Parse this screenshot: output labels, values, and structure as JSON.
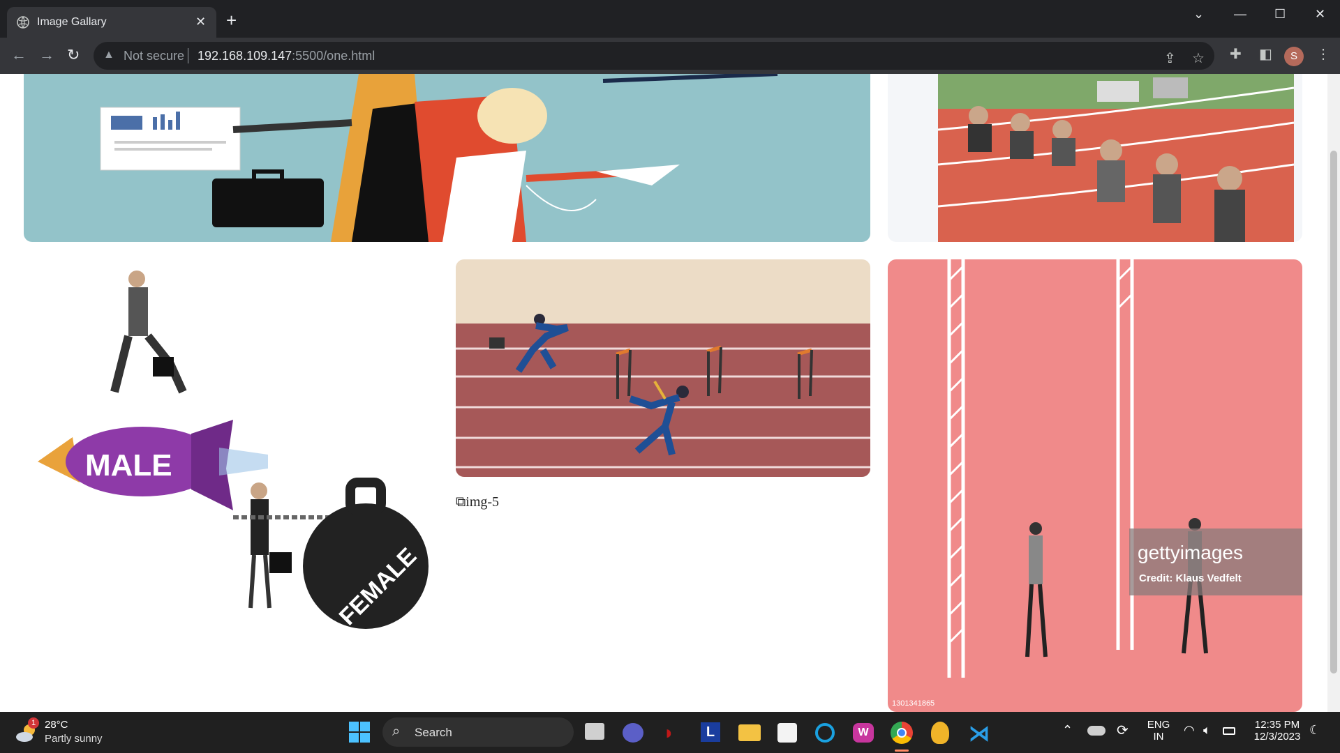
{
  "browser": {
    "tab_title": "Image Gallary",
    "url_warning": "Not secure",
    "url_host": "192.168.109.147",
    "url_rest": ":5500/one.html",
    "profile_initial": "S"
  },
  "gallery": {
    "broken_image_alt": "img-5",
    "watermark_brand": "gettyimages",
    "watermark_credit": "Credit: Klaus Vedfelt",
    "watermark_id": "1301341865",
    "rocket_label": "MALE",
    "weight_label": "FEMALE"
  },
  "taskbar": {
    "weather_badge": "1",
    "weather_temp": "28°C",
    "weather_desc": "Partly sunny",
    "search_label": "Search",
    "lang_1": "ENG",
    "lang_2": "IN",
    "time": "12:35 PM",
    "date": "12/3/2023",
    "apps": [
      "start-icon",
      "search-icon",
      "task-view-icon",
      "meet-icon",
      "mcafee-icon",
      "l-app-icon",
      "file-explorer-icon",
      "store-icon",
      "cortana-icon",
      "wps-icon",
      "chrome-icon",
      "badge-app-icon",
      "vscode-icon"
    ]
  }
}
